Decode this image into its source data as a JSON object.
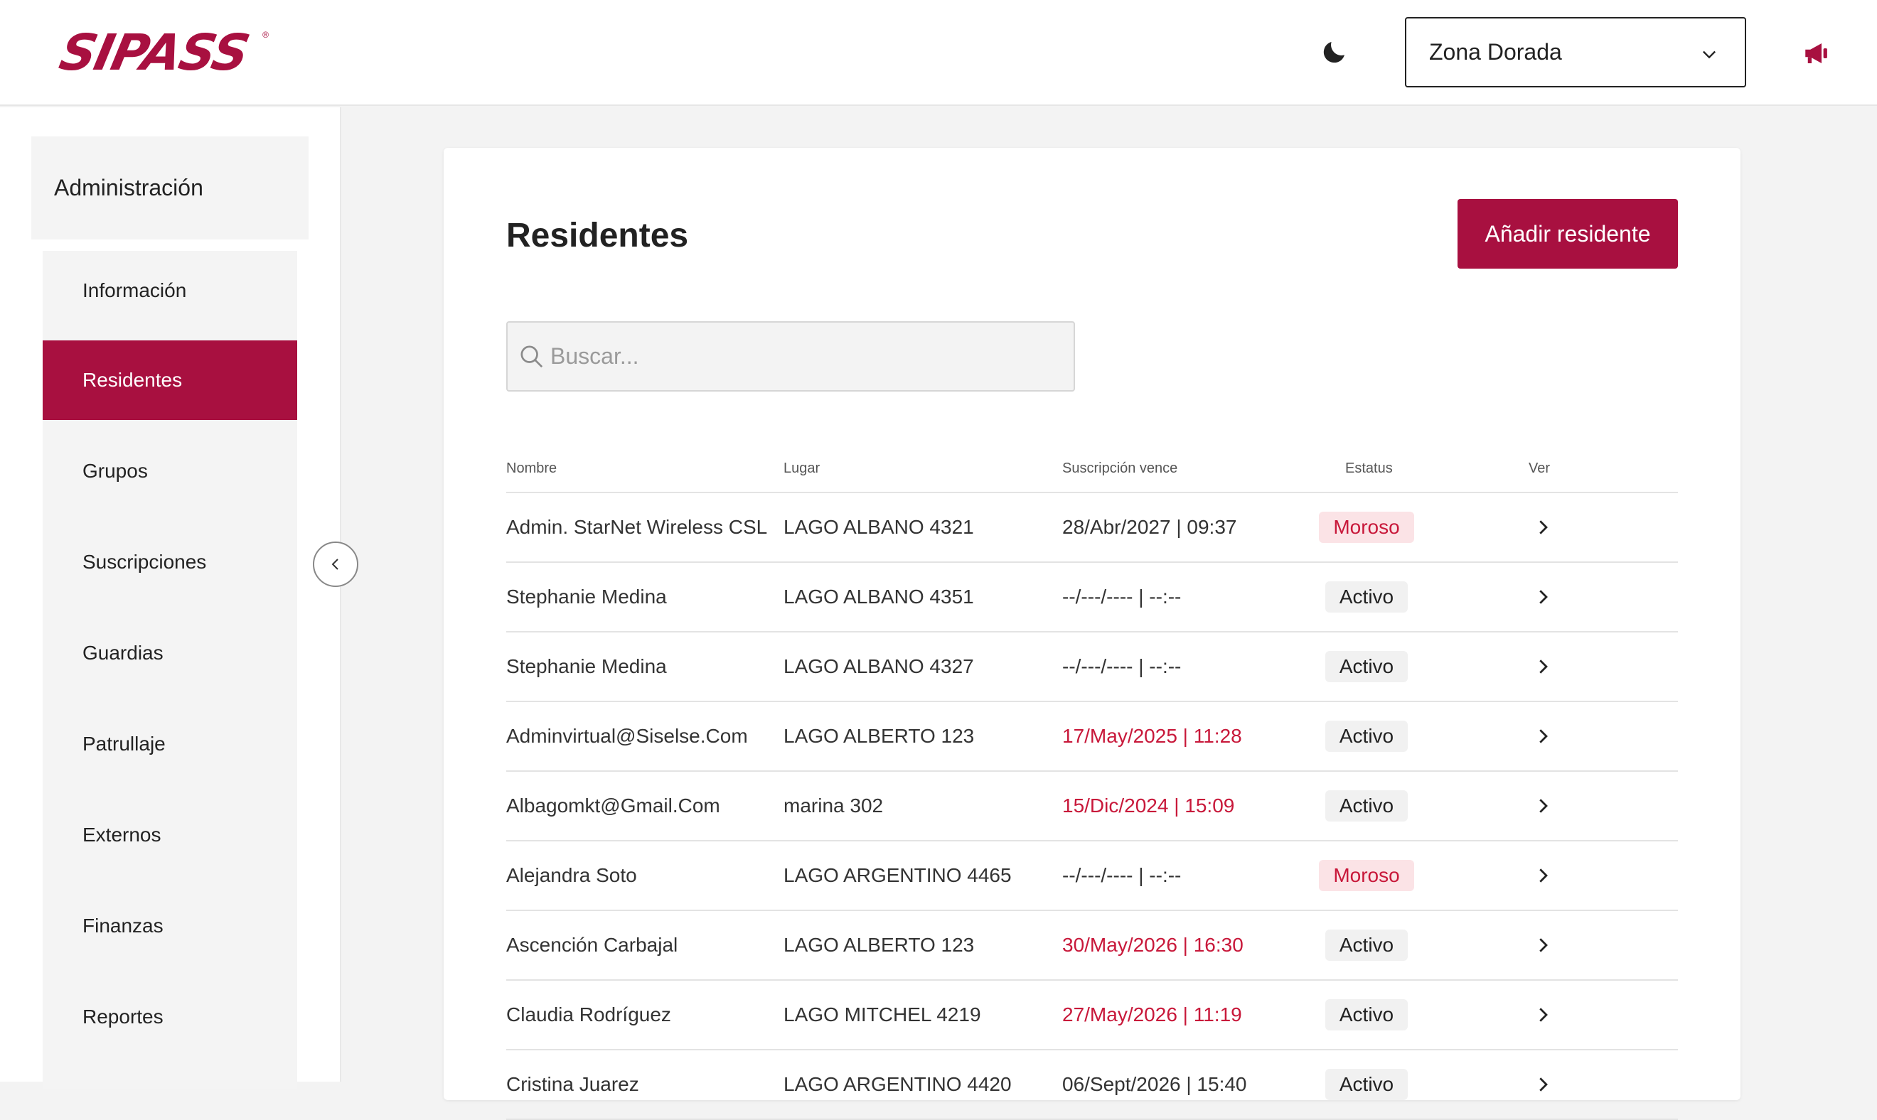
{
  "header": {
    "logo_text": "SIPASS",
    "logo_reg": "®",
    "zone_select": {
      "selected": "Zona Dorada"
    }
  },
  "sidebar": {
    "title": "Administración",
    "items": [
      {
        "label": "Información",
        "active": false
      },
      {
        "label": "Residentes",
        "active": true
      },
      {
        "label": "Grupos",
        "active": false
      },
      {
        "label": "Suscripciones",
        "active": false
      },
      {
        "label": "Guardias",
        "active": false
      },
      {
        "label": "Patrullaje",
        "active": false
      },
      {
        "label": "Externos",
        "active": false
      },
      {
        "label": "Finanzas",
        "active": false
      },
      {
        "label": "Reportes",
        "active": false
      }
    ]
  },
  "main": {
    "title": "Residentes",
    "add_button_label": "Añadir residente",
    "search": {
      "placeholder": "Buscar...",
      "value": ""
    },
    "table": {
      "columns": [
        "Nombre",
        "Lugar",
        "Suscripción vence",
        "Estatus",
        "Ver"
      ],
      "rows": [
        {
          "name": "Admin. StarNet Wireless CSL",
          "place": "LAGO ALBANO 4321",
          "expires": "28/Abr/2027 | 09:37",
          "expired": false,
          "status": "Moroso"
        },
        {
          "name": "Stephanie Medina",
          "place": "LAGO ALBANO 4351",
          "expires": "--/---/---- | --:--",
          "expired": false,
          "status": "Activo"
        },
        {
          "name": "Stephanie Medina",
          "place": "LAGO ALBANO 4327",
          "expires": "--/---/---- | --:--",
          "expired": false,
          "status": "Activo"
        },
        {
          "name": "Adminvirtual@Siselse.Com",
          "place": "LAGO ALBERTO 123",
          "expires": "17/May/2025 | 11:28",
          "expired": true,
          "status": "Activo"
        },
        {
          "name": "Albagomkt@Gmail.Com",
          "place": "marina 302",
          "expires": "15/Dic/2024 | 15:09",
          "expired": true,
          "status": "Activo"
        },
        {
          "name": "Alejandra Soto",
          "place": "LAGO ARGENTINO 4465",
          "expires": "--/---/---- | --:--",
          "expired": false,
          "status": "Moroso"
        },
        {
          "name": "Ascención Carbajal",
          "place": "LAGO ALBERTO 123",
          "expires": "30/May/2026 | 16:30",
          "expired": true,
          "status": "Activo"
        },
        {
          "name": "Claudia Rodríguez",
          "place": "LAGO MITCHEL 4219",
          "expires": "27/May/2026 | 11:19",
          "expired": true,
          "status": "Activo"
        },
        {
          "name": "Cristina Juarez",
          "place": "LAGO ARGENTINO 4420",
          "expires": "06/Sept/2026 | 15:40",
          "expired": false,
          "status": "Activo"
        }
      ]
    }
  },
  "colors": {
    "brand": "#a81040",
    "expired_text": "#c8183a",
    "moroso_bg": "#fbe3e6"
  },
  "icons": [
    "moon-icon",
    "chevron-down-icon",
    "megaphone-icon",
    "chevron-left-icon",
    "search-icon",
    "chevron-right-icon"
  ]
}
